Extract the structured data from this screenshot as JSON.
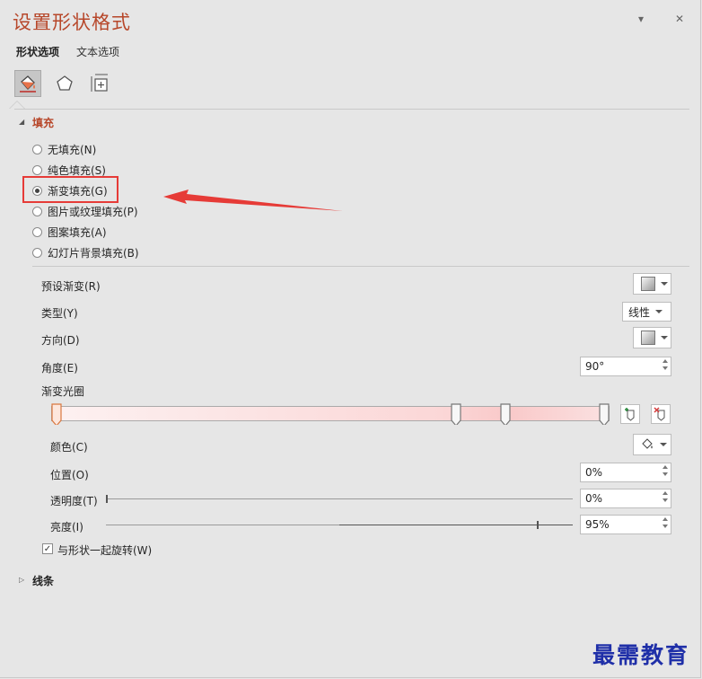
{
  "title": "设置形状格式",
  "header": {
    "dropdown_glyph": "▾",
    "close_glyph": "✕"
  },
  "tabs": [
    {
      "label": "形状选项",
      "active": true
    },
    {
      "label": "文本选项",
      "active": false
    }
  ],
  "icon_tabs": [
    "fill-line-icon",
    "effects-pentagon-icon",
    "size-properties-icon"
  ],
  "sections": {
    "fill": "填充",
    "line": "线条"
  },
  "fill_options": [
    {
      "label": "无填充(N)",
      "checked": false
    },
    {
      "label": "纯色填充(S)",
      "checked": false
    },
    {
      "label": "渐变填充(G)",
      "checked": true
    },
    {
      "label": "图片或纹理填充(P)",
      "checked": false
    },
    {
      "label": "图案填充(A)",
      "checked": false
    },
    {
      "label": "幻灯片背景填充(B)",
      "checked": false
    }
  ],
  "gradient": {
    "preset_label": "预设渐变(R)",
    "type_label": "类型(Y)",
    "type_value": "线性",
    "direction_label": "方向(D)",
    "angle_label": "角度(E)",
    "angle_value": "90°",
    "stops_label": "渐变光圈",
    "stops": [
      0,
      73,
      82,
      100
    ],
    "color_label": "颜色(C)",
    "position_label": "位置(O)",
    "position_value": "0%",
    "transparency_label": "透明度(T)",
    "transparency_value": "0%",
    "transparency": 0,
    "brightness_label": "亮度(I)",
    "brightness_value": "95%",
    "brightness": 0.95,
    "rotate_label": "与形状一起旋转(W)",
    "rotate_checked": true
  },
  "colors": {
    "accent": "#b7472a",
    "highlight_box": "#e63b37",
    "arrow": "#e63b37",
    "watermark": "#1f2fa8"
  },
  "watermark": "最需教育"
}
